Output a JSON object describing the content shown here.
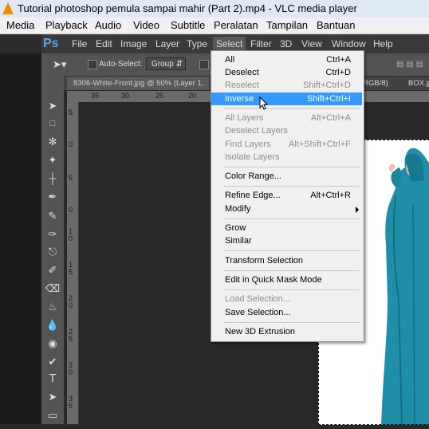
{
  "window": {
    "title": "Tutorial photoshop pemula sampai mahir (Part 2).mp4 - VLC media player"
  },
  "vlc_menu": [
    "Media",
    "Playback",
    "Audio",
    "Video",
    "Subtitle",
    "Peralatan",
    "Tampilan",
    "Bantuan"
  ],
  "ps": {
    "logo": "Ps",
    "menu": [
      "File",
      "Edit",
      "Image",
      "Layer",
      "Type",
      "Select",
      "Filter",
      "3D",
      "View",
      "Window",
      "Help"
    ],
    "active_menu": "Select",
    "options": {
      "auto_select_label": "Auto-Select:",
      "group_value": "Group"
    },
    "document_tab": "8306-White-Front.jpg @ 50% (Layer 1, ",
    "document_tab_right": "(RGB/8)",
    "document_tab2": "BOX.jp",
    "ruler_top": [
      "35",
      "30",
      "25",
      "20"
    ],
    "ruler_left": [
      "5",
      "0",
      "5",
      "0",
      "1 0",
      "1 5",
      "2 0",
      "2 5",
      "3 0",
      "3 5"
    ]
  },
  "select_menu": {
    "items": [
      {
        "label": "All",
        "shortcut": "Ctrl+A",
        "disabled": false
      },
      {
        "label": "Deselect",
        "shortcut": "Ctrl+D",
        "disabled": false
      },
      {
        "label": "Reselect",
        "shortcut": "Shift+Ctrl+D",
        "disabled": true
      },
      {
        "label": "Inverse",
        "shortcut": "Shift+Ctrl+I",
        "disabled": false,
        "highlighted": true
      },
      {
        "label": "All Layers",
        "shortcut": "Alt+Ctrl+A",
        "disabled": true
      },
      {
        "label": "Deselect Layers",
        "shortcut": "",
        "disabled": true
      },
      {
        "label": "Find Layers",
        "shortcut": "Alt+Shift+Ctrl+F",
        "disabled": true
      },
      {
        "label": "Isolate Layers",
        "shortcut": "",
        "disabled": true
      },
      {
        "label": "Color Range...",
        "shortcut": "",
        "disabled": false
      },
      {
        "label": "Refine Edge...",
        "shortcut": "Alt+Ctrl+R",
        "disabled": false
      },
      {
        "label": "Modify",
        "shortcut": "",
        "disabled": false,
        "submenu": true
      },
      {
        "label": "Grow",
        "shortcut": "",
        "disabled": false
      },
      {
        "label": "Similar",
        "shortcut": "",
        "disabled": false
      },
      {
        "label": "Transform Selection",
        "shortcut": "",
        "disabled": false
      },
      {
        "label": "Edit in Quick Mask Mode",
        "shortcut": "",
        "disabled": false
      },
      {
        "label": "Load Selection...",
        "shortcut": "",
        "disabled": true
      },
      {
        "label": "Save Selection...",
        "shortcut": "",
        "disabled": false
      },
      {
        "label": "New 3D Extrusion",
        "shortcut": "",
        "disabled": false
      }
    ]
  },
  "colors": {
    "highlight": "#3399ff",
    "ps_logo": "#5aa5e2",
    "figure": "#1f8fa8"
  }
}
